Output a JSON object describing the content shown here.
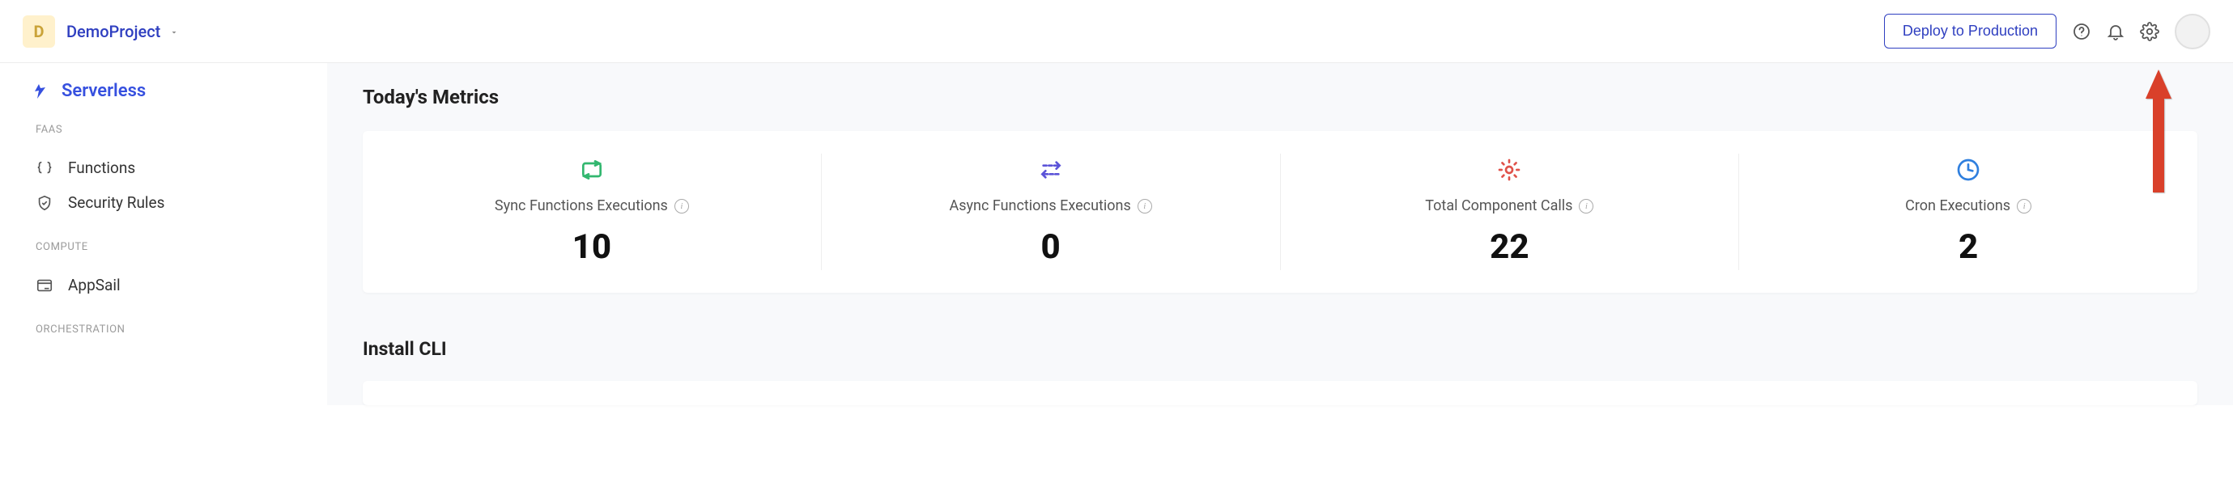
{
  "header": {
    "project_initial": "D",
    "project_name": "DemoProject",
    "deploy_label": "Deploy to Production"
  },
  "sidebar": {
    "brand_label": "Serverless",
    "sections": [
      {
        "hdr": "FAAS",
        "items": [
          {
            "label": "Functions"
          },
          {
            "label": "Security Rules"
          }
        ]
      },
      {
        "hdr": "COMPUTE",
        "items": [
          {
            "label": "AppSail"
          }
        ]
      },
      {
        "hdr": "ORCHESTRATION",
        "items": []
      }
    ]
  },
  "main": {
    "metrics_title": "Today's Metrics",
    "metrics": [
      {
        "label": "Sync Functions Executions",
        "value": "10",
        "icon_color": "#32b76f"
      },
      {
        "label": "Async Functions Executions",
        "value": "0",
        "icon_color": "#5b53d8"
      },
      {
        "label": "Total Component Calls",
        "value": "22",
        "icon_color": "#e0524a"
      },
      {
        "label": "Cron Executions",
        "value": "2",
        "icon_color": "#2f7fde"
      }
    ],
    "cli_title": "Install CLI"
  }
}
